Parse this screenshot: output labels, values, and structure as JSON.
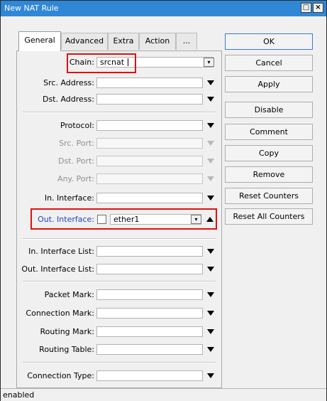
{
  "window": {
    "title": "New NAT Rule",
    "maximize_glyph": "□",
    "close_glyph": "×"
  },
  "tabs": [
    "General",
    "Advanced",
    "Extra",
    "Action",
    "..."
  ],
  "fields": {
    "chain": {
      "label": "Chain:",
      "value": "srcnat",
      "dropdown_glyph": "▾"
    },
    "src_address": {
      "label": "Src. Address:"
    },
    "dst_address": {
      "label": "Dst. Address:"
    },
    "protocol": {
      "label": "Protocol:"
    },
    "src_port": {
      "label": "Src. Port:"
    },
    "dst_port": {
      "label": "Dst. Port:"
    },
    "any_port": {
      "label": "Any. Port:"
    },
    "in_interface": {
      "label": "In. Interface:"
    },
    "out_interface": {
      "label": "Out. Interface:",
      "value": "ether1",
      "dropdown_glyph": "▾"
    },
    "in_interface_list": {
      "label": "In. Interface List:"
    },
    "out_interface_list": {
      "label": "Out. Interface List:"
    },
    "packet_mark": {
      "label": "Packet Mark:"
    },
    "connection_mark": {
      "label": "Connection Mark:"
    },
    "routing_mark": {
      "label": "Routing Mark:"
    },
    "routing_table": {
      "label": "Routing Table:"
    },
    "connection_type": {
      "label": "Connection Type:"
    }
  },
  "buttons": [
    "OK",
    "Cancel",
    "Apply",
    "Disable",
    "Comment",
    "Copy",
    "Remove",
    "Reset Counters",
    "Reset All Counters"
  ],
  "status": "enabled",
  "colors": {
    "titlebar": "#2f87d6",
    "highlight": "#e01010",
    "label_blue": "#2145c0"
  }
}
